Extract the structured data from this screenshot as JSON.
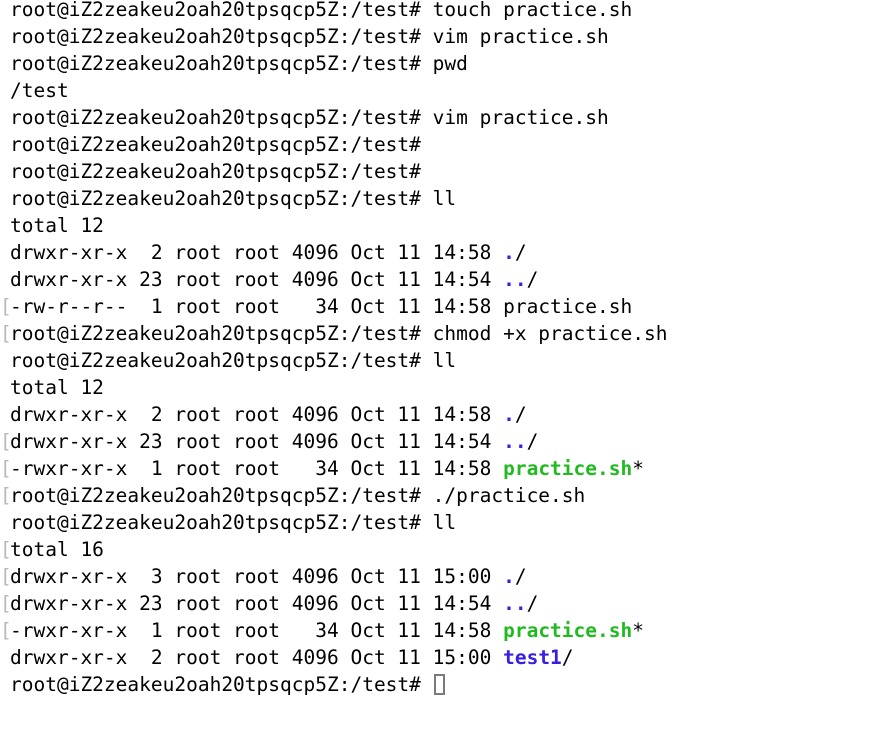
{
  "terminal": {
    "user": "root",
    "host": "iZ2zeakeu2oah20tpsqcp5Z",
    "cwd": "/test",
    "prompt": "root@iZ2zeakeu2oah20tpsqcp5Z:/test#",
    "colors": {
      "background": "#ffffff",
      "foreground": "#000000",
      "directory": "#3b1fe0",
      "executable": "#21ba21",
      "wrap_artifact": "#b9b9b9",
      "cursor_outline": "#7a7a7a"
    },
    "cursor": {
      "shape": "hollow-block",
      "focused": false
    },
    "lines": [
      {
        "bracket": false,
        "prompt": true,
        "command": " touch practice.sh"
      },
      {
        "bracket": false,
        "prompt": true,
        "command": " vim practice.sh"
      },
      {
        "bracket": false,
        "prompt": true,
        "command": " pwd"
      },
      {
        "bracket": false,
        "prompt": false,
        "text": "/test"
      },
      {
        "bracket": false,
        "prompt": true,
        "command": " vim practice.sh"
      },
      {
        "bracket": false,
        "prompt": true,
        "command": ""
      },
      {
        "bracket": false,
        "prompt": true,
        "command": ""
      },
      {
        "bracket": false,
        "prompt": true,
        "command": " ll"
      },
      {
        "bracket": false,
        "prompt": false,
        "text": "total 12"
      },
      {
        "bracket": false,
        "prompt": false,
        "text": "drwxr-xr-x  2 root root 4096 Oct 11 14:58 ",
        "name": "./",
        "nameType": "dir",
        "nameBase": ".",
        "nameSuffix": "/"
      },
      {
        "bracket": false,
        "prompt": false,
        "text": "drwxr-xr-x 23 root root 4096 Oct 11 14:54 ",
        "name": "../",
        "nameType": "dir",
        "nameBase": "..",
        "nameSuffix": "/"
      },
      {
        "bracket": true,
        "prompt": false,
        "text": "-rw-r--r--  1 root root   34 Oct 11 14:58 ",
        "name": "practice.sh",
        "nameType": "plain",
        "nameBase": "practice.sh",
        "nameSuffix": ""
      },
      {
        "bracket": true,
        "prompt": true,
        "command": " chmod +x practice.sh"
      },
      {
        "bracket": false,
        "prompt": true,
        "command": " ll"
      },
      {
        "bracket": false,
        "prompt": false,
        "text": "total 12"
      },
      {
        "bracket": false,
        "prompt": false,
        "text": "drwxr-xr-x  2 root root 4096 Oct 11 14:58 ",
        "name": "./",
        "nameType": "dir",
        "nameBase": ".",
        "nameSuffix": "/"
      },
      {
        "bracket": true,
        "prompt": false,
        "text": "drwxr-xr-x 23 root root 4096 Oct 11 14:54 ",
        "name": "../",
        "nameType": "dir",
        "nameBase": "..",
        "nameSuffix": "/"
      },
      {
        "bracket": true,
        "prompt": false,
        "text": "-rwxr-xr-x  1 root root   34 Oct 11 14:58 ",
        "name": "practice.sh*",
        "nameType": "exe",
        "nameBase": "practice.sh",
        "nameSuffix": "*"
      },
      {
        "bracket": true,
        "prompt": true,
        "command": " ./practice.sh"
      },
      {
        "bracket": false,
        "prompt": true,
        "command": " ll"
      },
      {
        "bracket": true,
        "prompt": false,
        "text": "total 16"
      },
      {
        "bracket": true,
        "prompt": false,
        "text": "drwxr-xr-x  3 root root 4096 Oct 11 15:00 ",
        "name": "./",
        "nameType": "dir",
        "nameBase": ".",
        "nameSuffix": "/"
      },
      {
        "bracket": true,
        "prompt": false,
        "text": "drwxr-xr-x 23 root root 4096 Oct 11 14:54 ",
        "name": "../",
        "nameType": "dir",
        "nameBase": "..",
        "nameSuffix": "/"
      },
      {
        "bracket": true,
        "prompt": false,
        "text": "-rwxr-xr-x  1 root root   34 Oct 11 14:58 ",
        "name": "practice.sh*",
        "nameType": "exe",
        "nameBase": "practice.sh",
        "nameSuffix": "*"
      },
      {
        "bracket": false,
        "prompt": false,
        "text": "drwxr-xr-x  2 root root 4096 Oct 11 15:00 ",
        "name": "test1/",
        "nameType": "dir",
        "nameBase": "test1",
        "nameSuffix": "/"
      },
      {
        "bracket": false,
        "prompt": true,
        "command": " ",
        "cursor": true
      }
    ]
  }
}
